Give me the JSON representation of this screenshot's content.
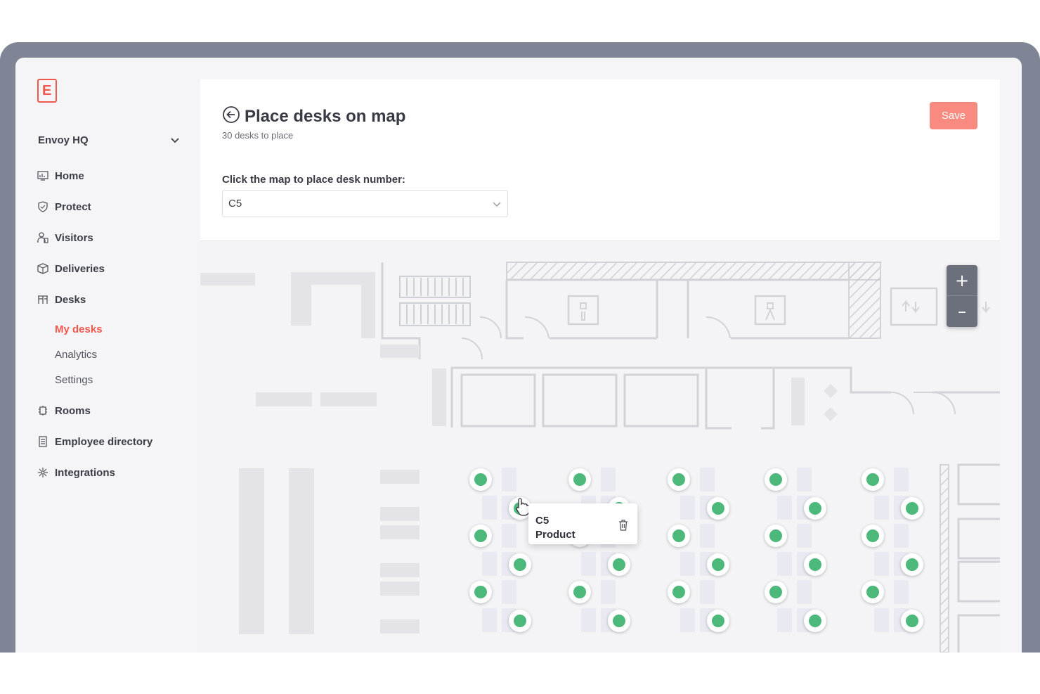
{
  "sidebar": {
    "logo_letter": "E",
    "location": "Envoy HQ",
    "nav": [
      {
        "label": "Home",
        "icon": "home-icon"
      },
      {
        "label": "Protect",
        "icon": "shield-icon"
      },
      {
        "label": "Visitors",
        "icon": "visitors-icon"
      },
      {
        "label": "Deliveries",
        "icon": "package-icon"
      },
      {
        "label": "Desks",
        "icon": "desk-icon"
      },
      {
        "label": "Rooms",
        "icon": "rooms-icon"
      },
      {
        "label": "Employee directory",
        "icon": "directory-icon"
      },
      {
        "label": "Integrations",
        "icon": "integrations-icon"
      }
    ],
    "desks_sub": [
      {
        "label": "My desks",
        "active": true
      },
      {
        "label": "Analytics",
        "active": false
      },
      {
        "label": "Settings",
        "active": false
      }
    ]
  },
  "header": {
    "title": "Place desks on map",
    "subtitle": "30 desks to place",
    "save_label": "Save"
  },
  "form": {
    "label": "Click the map to place desk number:",
    "selected": "C5"
  },
  "map": {
    "popup": {
      "desk": "C5",
      "neighborhood": "Product"
    },
    "zoom_in": "+",
    "zoom_out": "–",
    "desk_marker_color": "#4cb879",
    "accent": "#f0584b"
  }
}
